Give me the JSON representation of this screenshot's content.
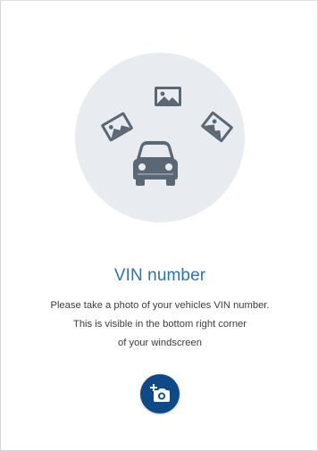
{
  "screen": {
    "title": "VIN number",
    "description_lines": [
      "Please take a photo of your vehicles VIN number.",
      "This is visible in the bottom right corner",
      "of your windscreen"
    ]
  },
  "illustration": {
    "icons": [
      "car-icon",
      "image-icon",
      "image-icon",
      "image-icon"
    ],
    "circle_color": "#e8ebef",
    "icon_color": "#5a6774"
  },
  "capture_button": {
    "icon": "add-photo-icon",
    "color": "#0d4a87"
  },
  "colors": {
    "title": "#2f73ad",
    "text": "#3a3c40",
    "background": "#ffffff"
  }
}
